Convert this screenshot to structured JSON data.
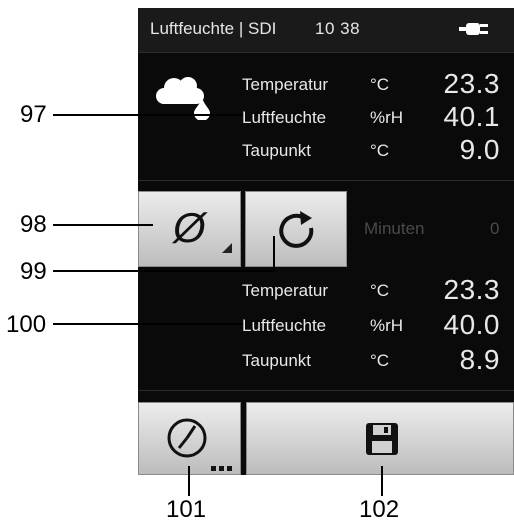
{
  "status": {
    "title": "Luftfeuchte | SDI",
    "time": "10 38",
    "power_icon": "plug-icon"
  },
  "measure1": {
    "rows": [
      {
        "label": "Temperatur",
        "unit": "°C",
        "value": "23.3"
      },
      {
        "label": "Luftfeuchte",
        "unit": "%rH",
        "value": "40.1"
      },
      {
        "label": "Taupunkt",
        "unit": "°C",
        "value": "9.0"
      }
    ]
  },
  "controls": {
    "null_symbol": "Ø",
    "minutes_label": "Minuten",
    "minutes_value": "0"
  },
  "measure2": {
    "rows": [
      {
        "label": "Temperatur",
        "unit": "°C",
        "value": "23.3"
      },
      {
        "label": "Luftfeuchte",
        "unit": "%rH",
        "value": "40.0"
      },
      {
        "label": "Taupunkt",
        "unit": "°C",
        "value": "8.9"
      }
    ]
  },
  "callouts": {
    "c97": "97",
    "c98": "98",
    "c99": "99",
    "c100": "100",
    "c101": "101",
    "c102": "102"
  },
  "colors": {
    "screen_bg": "#0a0a0a",
    "statusbar_bg": "#1a1a1a",
    "text": "#e8e8e8",
    "button_light": "#ececec",
    "button_dark": "#bdbdbd",
    "disabled_text": "#4a4a4a"
  }
}
